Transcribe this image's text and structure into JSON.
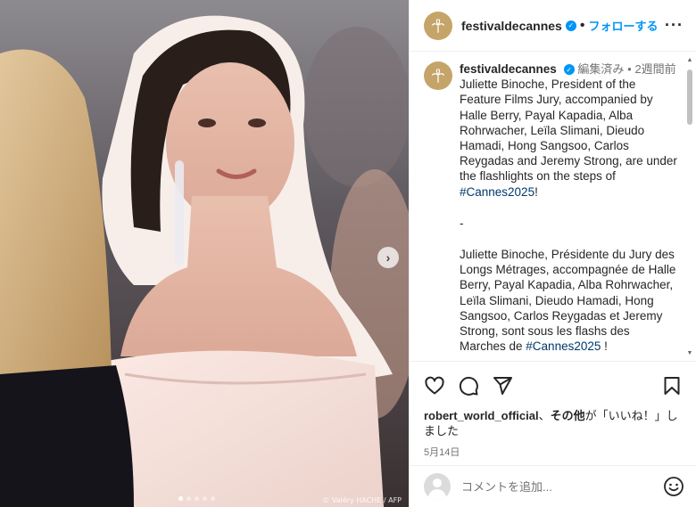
{
  "photo": {
    "credit": "© Valéry HACHE / AFP",
    "carousel_dots": 5,
    "active_dot": 0,
    "next_icon": "chevron-right-icon"
  },
  "header": {
    "username": "festivaldecannes",
    "separator": "•",
    "follow_label": "フォローする",
    "more_icon": "ellipsis-icon"
  },
  "caption": {
    "username": "festivaldecannes",
    "edited": "編集済み",
    "meta_sep": "•",
    "time": "2週間前",
    "en_text": "Juliette Binoche, President of the Feature Films Jury, accompanied by Halle Berry, Payal Kapadia, Alba Rohrwacher, Leïla Slimani, Dieudo Hamadi, Hong Sangsoo, Carlos Reygadas and Jeremy Strong, are under the flashlights on the steps of ",
    "en_hashtag": "#Cannes2025",
    "en_end": "!",
    "divider": "-",
    "fr_text": "Juliette Binoche, Présidente du Jury des Longs Métrages, accompagnée de Halle Berry, Payal Kapadia, Alba Rohrwacher, Leïla Slimani, Dieudo Hamadi, Hong Sangsoo, Carlos Reygadas et Jeremy Strong, sont sous les flashs des Marches de ",
    "fr_hashtag": "#Cannes2025",
    "fr_end": " !"
  },
  "actions": {
    "icons": [
      "heart-icon",
      "comment-icon",
      "share-icon",
      "bookmark-icon"
    ],
    "likes_user": "robert_world_official",
    "likes_mid": "、",
    "likes_others": "その他",
    "likes_suffix": "が「いいね！」しました",
    "date": "5月14日"
  },
  "comment": {
    "placeholder": "コメントを追加...",
    "emoji_icon": "smiley-icon"
  },
  "colors": {
    "accent": "#0095f6",
    "brand_gold": "#c5a46a",
    "hashtag": "#00376b"
  }
}
